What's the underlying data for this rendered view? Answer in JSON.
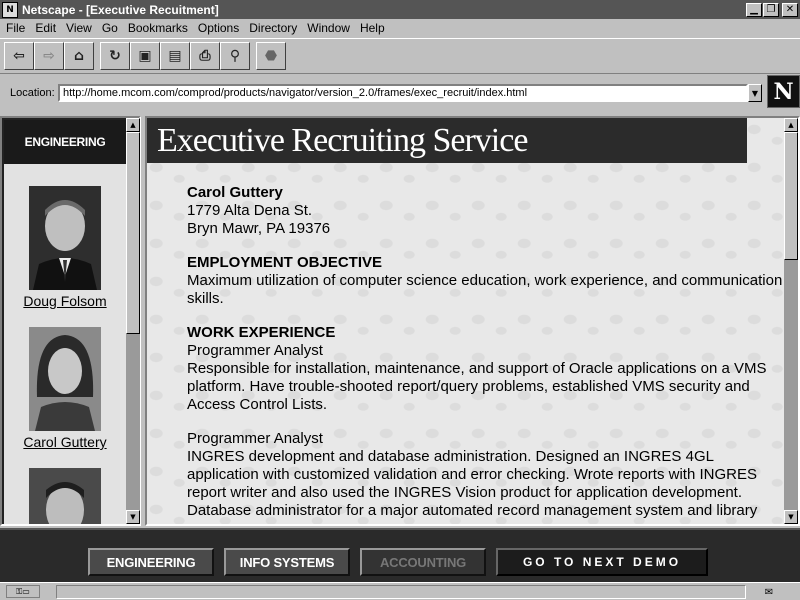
{
  "window": {
    "title": "Netscape - [Executive Recuitment]",
    "app_icon": "N"
  },
  "menu": [
    "File",
    "Edit",
    "View",
    "Go",
    "Bookmarks",
    "Options",
    "Directory",
    "Window",
    "Help"
  ],
  "toolbar_icons": [
    "back-icon",
    "forward-icon",
    "home-icon",
    "reload-icon",
    "images-icon",
    "open-icon",
    "print-icon",
    "find-icon",
    "stop-icon"
  ],
  "location": {
    "label": "Location:",
    "url": "http://home.mcom.com/comprod/products/navigator/version_2.0/frames/exec_recruit/index.html"
  },
  "logo": "N",
  "left_frame": {
    "header": "ENGINEERING",
    "people": [
      {
        "name": "Doug Folsom"
      },
      {
        "name": "Carol Guttery"
      },
      {
        "name": ""
      }
    ]
  },
  "banner": {
    "title": "Executive Recruiting Service"
  },
  "resume": {
    "name": "Carol Guttery",
    "address1": "1779 Alta Dena St.",
    "address2": "Bryn Mawr, PA 19376",
    "objective_heading": "EMPLOYMENT OBJECTIVE",
    "objective_text": "Maximum utilization of computer science education, work experience, and communication skills.",
    "work_heading": "WORK EXPERIENCE",
    "jobs": [
      {
        "title": "Programmer Analyst",
        "description": "Responsible for installation, maintenance, and support of Oracle applications on a VMS platform. Have trouble-shooted report/query problems, established VMS security and Access Control Lists."
      },
      {
        "title": "Programmer Analyst",
        "description": "INGRES development and database administration. Designed an INGRES 4GL application with customized validation and error checking. Wrote reports with INGRES report writer and also used the INGRES Vision product for application development. Database administrator for a major automated record management system and library"
      }
    ]
  },
  "bottom_nav": {
    "engineering": "ENGINEERING",
    "info_systems": "INFO SYSTEMS",
    "accounting": "ACCOUNTING",
    "next_demo": "GO TO NEXT DEMO"
  }
}
